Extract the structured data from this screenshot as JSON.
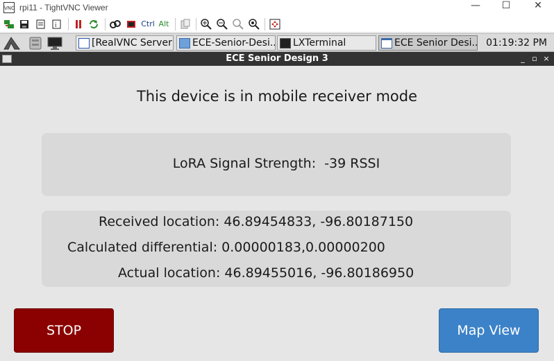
{
  "viewer": {
    "title": "rpi11 - TightVNC Viewer",
    "app_icon_text": "VNC",
    "minimize_glyph": "—",
    "maximize_glyph": "☐",
    "close_glyph": "✕",
    "toolbar": {
      "ctrl_label": "Ctrl",
      "alt_label": "Alt"
    }
  },
  "taskbar": {
    "tasks": [
      {
        "label": "[RealVNC Server]",
        "icon": "realvnc-icon"
      },
      {
        "label": "ECE-Senior-Desi...",
        "icon": "folder-icon"
      },
      {
        "label": "LXTerminal",
        "icon": "terminal-icon"
      },
      {
        "label": "ECE Senior Desi...",
        "icon": "window-icon"
      }
    ],
    "clock": "01:19:32 PM"
  },
  "window": {
    "title": "ECE Senior Design 3",
    "min_glyph": "_",
    "max_glyph": "▫",
    "close_glyph": "×"
  },
  "app": {
    "mode_text": "This device is in mobile receiver mode",
    "signal_text": "LoRA Signal Strength:  -39 RSSI",
    "received_location": "Received location: 46.89454833, -96.80187150",
    "calculated_differential": "Calculated differential: 0.00000183,0.00000200",
    "actual_location": "Actual location: 46.89455016, -96.80186950",
    "stop_label": "STOP",
    "map_view_label": "Map View"
  },
  "colors": {
    "stop": "#8b0000",
    "map_view": "#3c82c8",
    "panel": "#d9d9d9",
    "background": "#e6e6e6",
    "window_titlebar": "#333333"
  }
}
